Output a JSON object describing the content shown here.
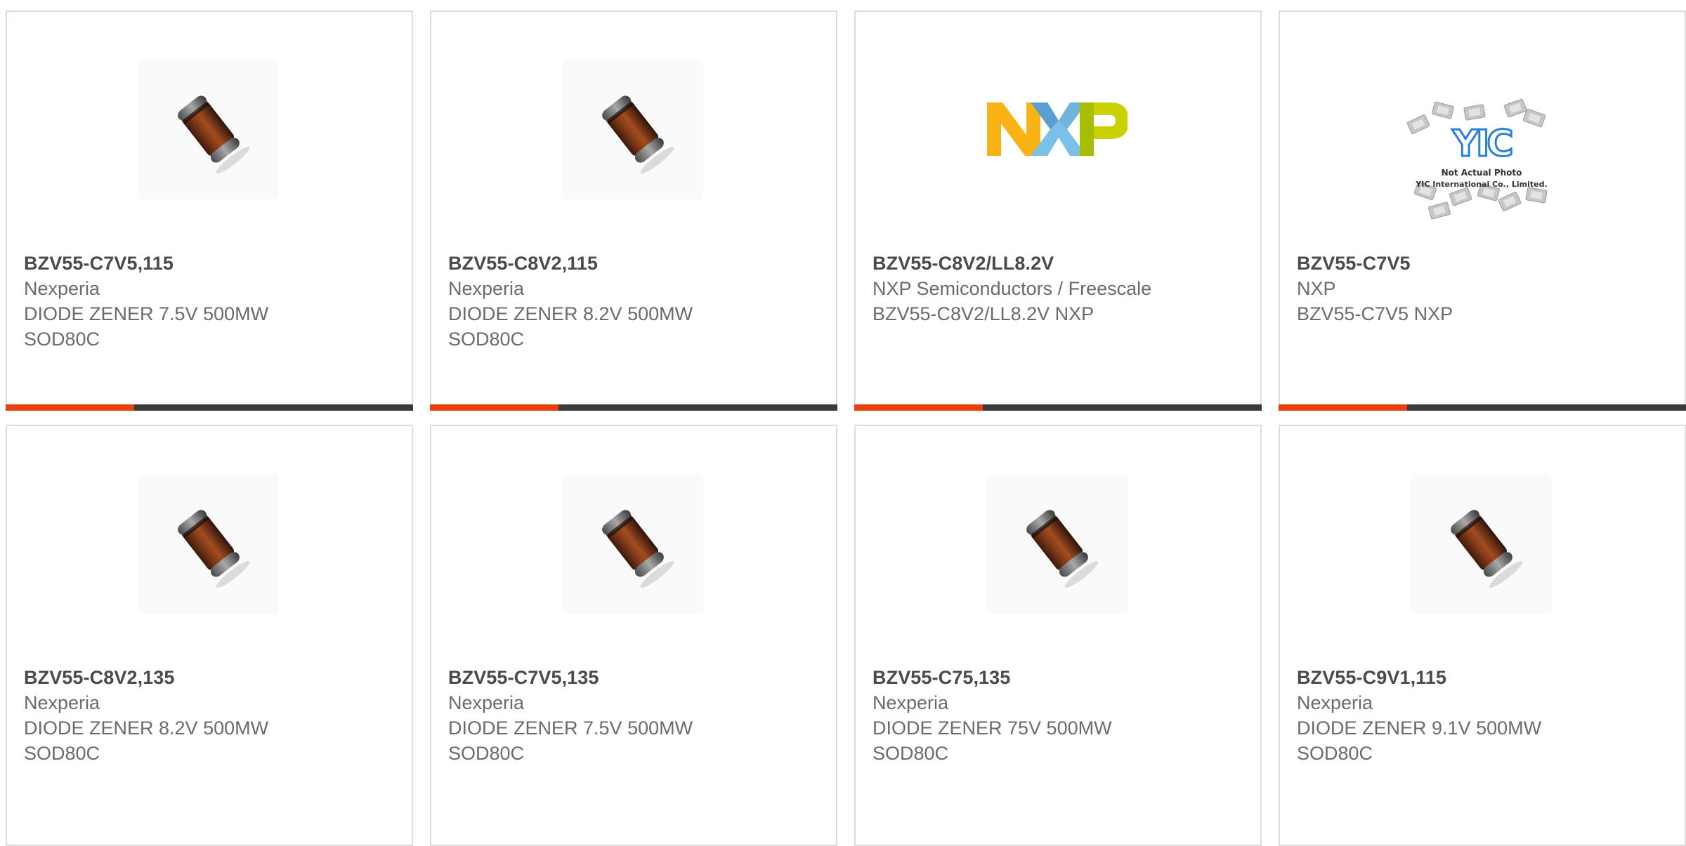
{
  "accent_color": "#e8400f",
  "bar_color": "#3a3a3a",
  "products": [
    {
      "part_number": "BZV55-C7V5,115",
      "manufacturer": "Nexperia",
      "description": "DIODE ZENER 7.5V 500MW",
      "package": "SOD80C",
      "image": "sod80-diode-photo-icon"
    },
    {
      "part_number": "BZV55-C8V2,115",
      "manufacturer": "Nexperia",
      "description": "DIODE ZENER 8.2V 500MW",
      "package": "SOD80C",
      "image": "sod80-diode-photo-icon"
    },
    {
      "part_number": "BZV55-C8V2/LL8.2V",
      "manufacturer": "NXP Semiconductors / Freescale",
      "description": "BZV55-C8V2/LL8.2V NXP",
      "package": "",
      "image": "nxp-logo-icon"
    },
    {
      "part_number": "BZV55-C7V5",
      "manufacturer": "NXP",
      "description": "BZV55-C7V5 NXP",
      "package": "",
      "image": "yic-placeholder-icon",
      "image_caption": [
        "Not Actual Photo",
        "YIC International Co., Limited."
      ]
    },
    {
      "part_number": "BZV55-C8V2,135",
      "manufacturer": "Nexperia",
      "description": "DIODE ZENER 8.2V 500MW",
      "package": "SOD80C",
      "image": "sod80-diode-photo-icon"
    },
    {
      "part_number": "BZV55-C7V5,135",
      "manufacturer": "Nexperia",
      "description": "DIODE ZENER 7.5V 500MW",
      "package": "SOD80C",
      "image": "sod80-diode-photo-icon"
    },
    {
      "part_number": "BZV55-C75,135",
      "manufacturer": "Nexperia",
      "description": "DIODE ZENER 75V 500MW",
      "package": "SOD80C",
      "image": "sod80-diode-photo-icon"
    },
    {
      "part_number": "BZV55-C9V1,115",
      "manufacturer": "Nexperia",
      "description": "DIODE ZENER 9.1V 500MW",
      "package": "SOD80C",
      "image": "sod80-diode-photo-icon"
    }
  ]
}
